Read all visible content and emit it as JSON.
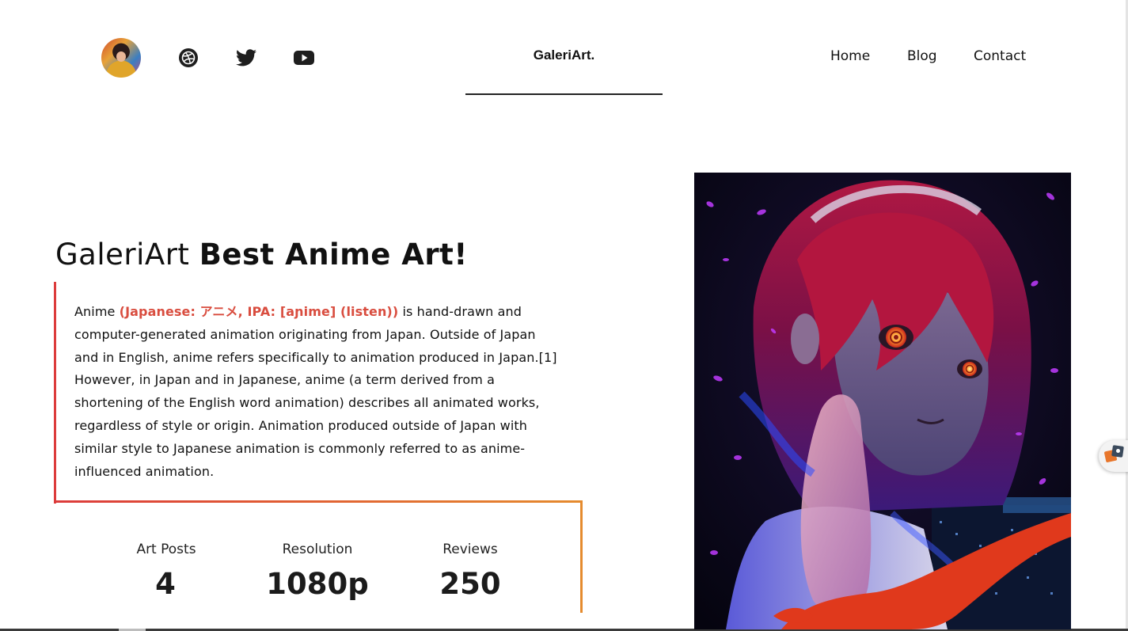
{
  "header": {
    "avatar_alt": "profile avatar",
    "social_icons": [
      "dribbble-icon",
      "twitter-icon",
      "youtube-icon"
    ],
    "brand": "GaleriArt.",
    "nav": [
      {
        "label": "Home"
      },
      {
        "label": "Blog"
      },
      {
        "label": "Contact"
      }
    ]
  },
  "hero": {
    "title_light": "GaleriArt",
    "title_bold": "Best Anime Art!",
    "desc_lead": "Anime ",
    "desc_highlight": "(Japanese: アニメ, IPA: [aɲime] (listen))",
    "desc_rest": " is hand-drawn and computer-generated animation originating from Japan. Outside of Japan and in English, anime refers specifically to animation produced in Japan.[1] However, in Japan and in Japanese, anime (a term derived from a shortening of the English word animation) describes all animated works, regardless of style or origin. Animation produced outside of Japan with similar style to Japanese animation is commonly referred to as anime-influenced animation."
  },
  "stats": [
    {
      "label": "Art Posts",
      "value": "4"
    },
    {
      "label": "Resolution",
      "value": "1080p"
    },
    {
      "label": "Reviews",
      "value": "250"
    }
  ],
  "colors": {
    "accent_red": "#dc3b3b",
    "accent_orange": "#e58b2e",
    "highlight_text": "#d94d3f"
  },
  "artwork": {
    "alt": "anime girl with red hair and ringed eyes"
  },
  "widget": {
    "icon": "translate-icon"
  }
}
